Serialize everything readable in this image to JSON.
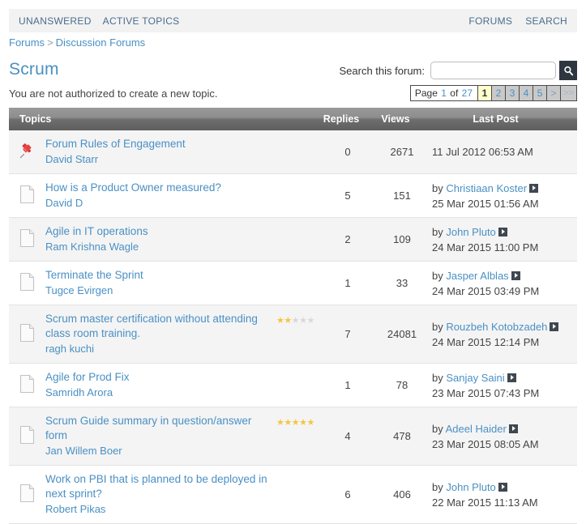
{
  "topnav": {
    "left": [
      {
        "label": "UNANSWERED",
        "name": "nav-unanswered"
      },
      {
        "label": "ACTIVE TOPICS",
        "name": "nav-active-topics"
      }
    ],
    "right": [
      {
        "label": "FORUMS",
        "name": "nav-forums"
      },
      {
        "label": "SEARCH",
        "name": "nav-search"
      }
    ]
  },
  "breadcrumb": {
    "root": "Forums",
    "separator": ">",
    "current": "Discussion Forums"
  },
  "header": {
    "title": "Scrum",
    "notice": "You are not authorized to create a new topic."
  },
  "search": {
    "label": "Search this forum:",
    "value": "",
    "placeholder": "",
    "button_icon": "search-icon"
  },
  "pagination": {
    "info_prefix": "Page",
    "current_page": "1",
    "info_middle": "of",
    "total_pages": "27",
    "pages": [
      "1",
      "2",
      "3",
      "4",
      "5"
    ],
    "next_label": ">",
    "last_label": ">>"
  },
  "table": {
    "columns": {
      "topics": "Topics",
      "replies": "Replies",
      "views": "Views",
      "last_post": "Last Post"
    },
    "rows": [
      {
        "icon": "pin-icon",
        "title": "Forum Rules of Engagement",
        "author": "David Starr",
        "stars": 0,
        "replies": "0",
        "views": "2671",
        "last_post_by": "",
        "last_post_prefix": "",
        "last_post_date": "11 Jul 2012 06:53 AM",
        "has_goto": false
      },
      {
        "icon": "topic-icon",
        "title": "How is a Product Owner measured?",
        "author": "David D",
        "stars": 0,
        "replies": "5",
        "views": "151",
        "last_post_prefix": "by",
        "last_post_by": "Christiaan Koster",
        "last_post_date": "25 Mar 2015 01:56 AM",
        "has_goto": true
      },
      {
        "icon": "topic-icon",
        "title": "Agile in IT operations",
        "author": "Ram Krishna Wagle",
        "stars": 0,
        "replies": "2",
        "views": "109",
        "last_post_prefix": "by",
        "last_post_by": "John Pluto",
        "last_post_date": "24 Mar 2015 11:00 PM",
        "has_goto": true
      },
      {
        "icon": "topic-icon",
        "title": "Terminate the Sprint",
        "author": "Tugce Evirgen",
        "stars": 0,
        "replies": "1",
        "views": "33",
        "last_post_prefix": "by",
        "last_post_by": "Jasper Alblas",
        "last_post_date": "24 Mar 2015 03:49 PM",
        "has_goto": true
      },
      {
        "icon": "topic-icon",
        "title": "Scrum master certification without attending class room training.",
        "author": "ragh kuchi",
        "stars": 2,
        "replies": "7",
        "views": "24081",
        "last_post_prefix": "by",
        "last_post_by": "Rouzbeh Kotobzadeh",
        "last_post_date": "24 Mar 2015 12:14 PM",
        "has_goto": true
      },
      {
        "icon": "topic-icon",
        "title": "Agile for Prod Fix",
        "author": "Samridh Arora",
        "stars": 0,
        "replies": "1",
        "views": "78",
        "last_post_prefix": "by",
        "last_post_by": "Sanjay Saini",
        "last_post_date": "23 Mar 2015 07:43 PM",
        "has_goto": true
      },
      {
        "icon": "topic-icon",
        "title": "Scrum Guide summary in question/answer form",
        "author": "Jan Willem Boer",
        "stars": 5,
        "replies": "4",
        "views": "478",
        "last_post_prefix": "by",
        "last_post_by": "Adeel Haider",
        "last_post_date": "23 Mar 2015 08:05 AM",
        "has_goto": true
      },
      {
        "icon": "topic-icon",
        "title": "Work on PBI that is planned to be deployed in next sprint?",
        "author": "Robert Pikas",
        "stars": 0,
        "replies": "6",
        "views": "406",
        "last_post_prefix": "by",
        "last_post_by": "John Pluto",
        "last_post_date": "22 Mar 2015 11:13 AM",
        "has_goto": true
      }
    ]
  },
  "colors": {
    "link": "#4a90c4",
    "nav_link": "#4a6c8c",
    "star_on": "#f4c542",
    "star_off": "#d8d8d8",
    "row_alt": "#f4f4f4",
    "header_gradient_top": "#9a9a9a",
    "header_gradient_bottom": "#5e5e5e",
    "current_page_bg": "#ffffcc"
  }
}
